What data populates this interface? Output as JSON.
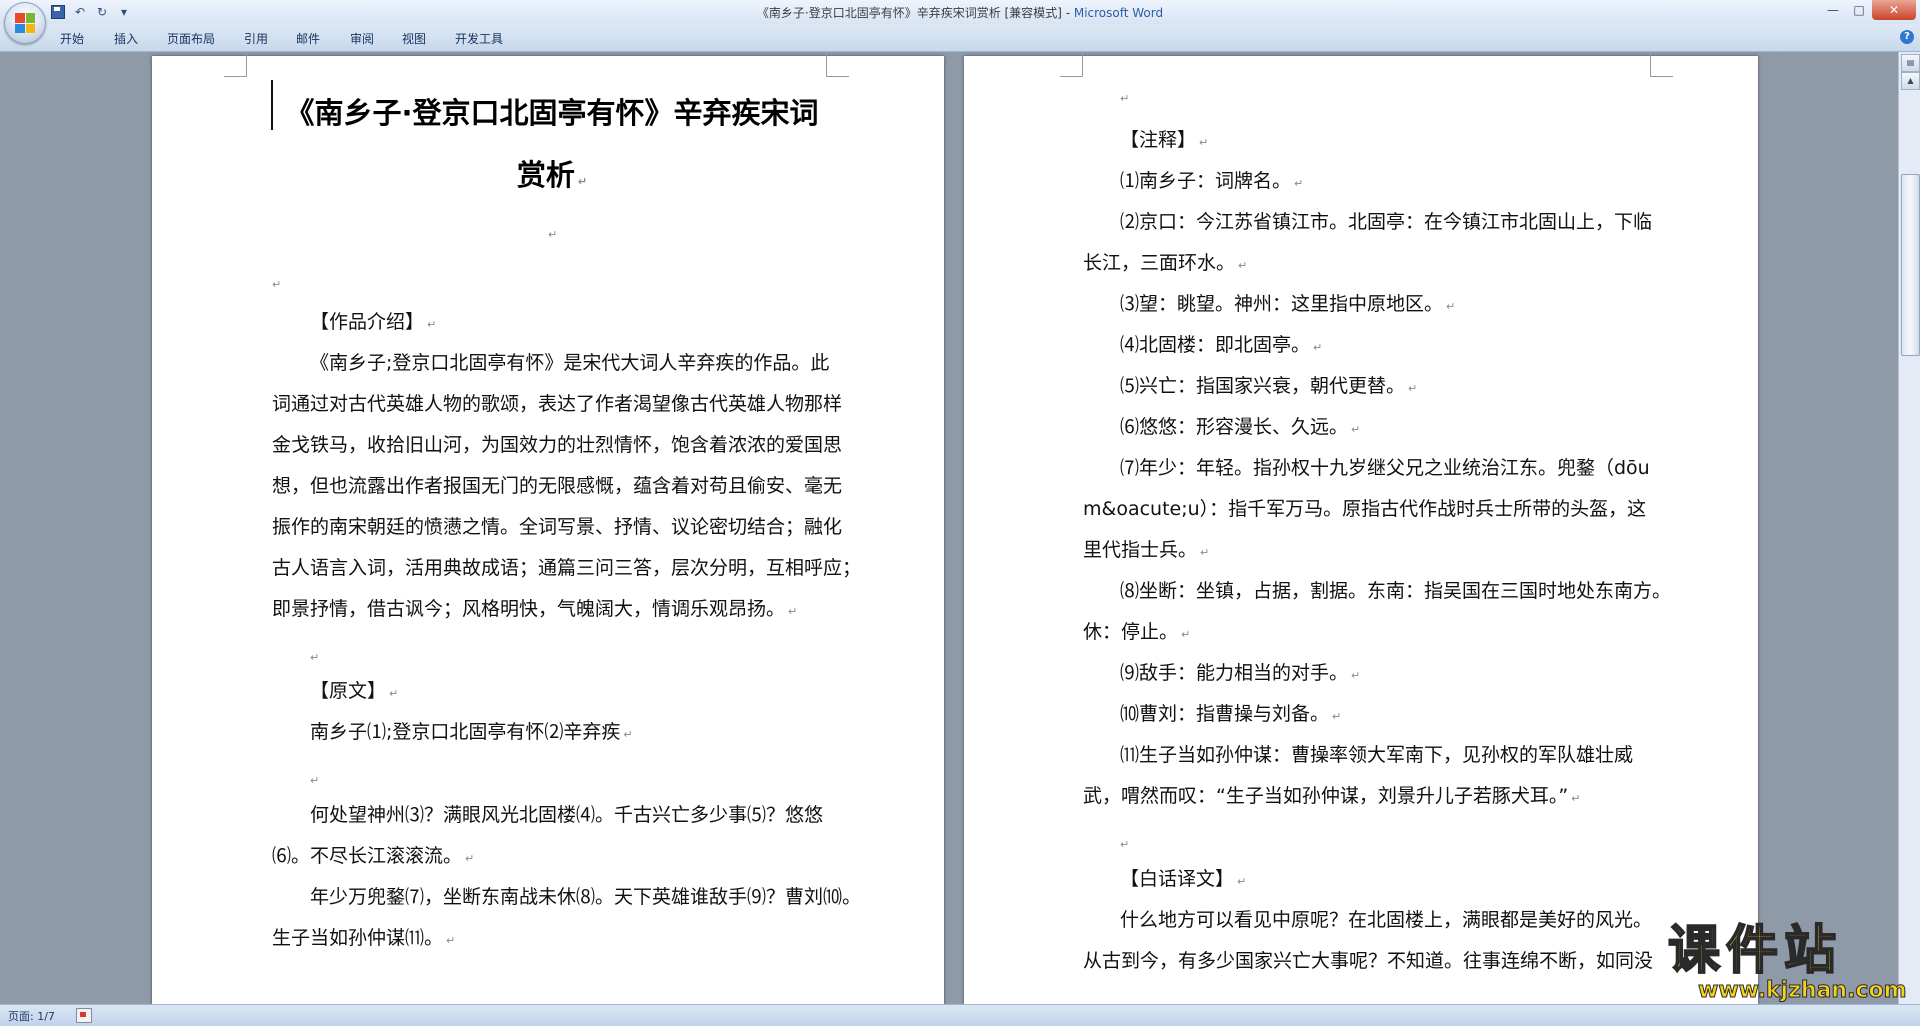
{
  "window": {
    "title_doc": "《南乡子·登京口北固亭有怀》辛弃疾宋词赏析 [兼容模式]",
    "title_sep": " - ",
    "title_app": "Microsoft Word"
  },
  "ribbon": {
    "tabs": [
      "开始",
      "插入",
      "页面布局",
      "引用",
      "邮件",
      "审阅",
      "视图",
      "开发工具"
    ]
  },
  "page_left": {
    "title_line1": "《南乡子·登京口北固亭有怀》辛弃疾宋词",
    "title_line2": "赏析",
    "intro_heading": "【作品介绍】",
    "intro_lines": [
      "《南乡子;登京口北固亭有怀》是宋代大词人辛弃疾的作品。此",
      "词通过对古代英雄人物的歌颂，表达了作者渴望像古代英雄人物那样",
      "金戈铁马，收拾旧山河，为国效力的壮烈情怀，饱含着浓浓的爱国思",
      "想，但也流露出作者报国无门的无限感慨，蕴含着对苟且偷安、毫无",
      "振作的南宋朝廷的愤懑之情。全词写景、抒情、议论密切结合；融化",
      "古人语言入词，活用典故成语；通篇三问三答，层次分明，互相呼应；",
      "即景抒情，借古讽今；风格明快，气魄阔大，情调乐观昂扬。"
    ],
    "original_heading": "【原文】",
    "poem_title": "南乡子⑴;登京口北固亭有怀⑵辛弃疾",
    "poem_lines": [
      "何处望神州⑶？满眼风光北固楼⑷。千古兴亡多少事⑸？悠悠",
      "⑹。不尽长江滚滚流。",
      "年少万兜鍪⑺，坐断东南战未休⑻。天下英雄谁敌手⑼？曹刘⑽。",
      "生子当如孙仲谋⑾。"
    ]
  },
  "page_right": {
    "notes_heading": "【注释】",
    "note_lines": [
      "⑴南乡子：词牌名。",
      "⑵京口：今江苏省镇江市。北固亭：在今镇江市北固山上，下临",
      "长江，三面环水。",
      "⑶望：眺望。神州：这里指中原地区。",
      "⑷北固楼：即北固亭。",
      "⑸兴亡：指国家兴衰，朝代更替。",
      "⑹悠悠：形容漫长、久远。",
      "⑺年少：年轻。指孙权十九岁继父兄之业统治江东。兜鍪（dōu",
      "m&oacute;u）：指千军万马。原指古代作战时兵士所带的头盔，这",
      "里代指士兵。",
      "⑻坐断：坐镇，占据，割据。东南：指吴国在三国时地处东南方。",
      "休：停止。",
      "⑼敌手：能力相当的对手。",
      "⑽曹刘：指曹操与刘备。",
      "⑾生子当如孙仲谋：曹操率领大军南下，见孙权的军队雄壮威",
      "武，喟然而叹：“生子当如孙仲谋，刘景升儿子若豚犬耳。”"
    ],
    "translation_heading": "【白话译文】",
    "translation_lines": [
      "什么地方可以看见中原呢？在北固楼上，满眼都是美好的风光。",
      "从古到今，有多少国家兴亡大事呢？不知道。往事连绵不断，如同没"
    ]
  },
  "statusbar": {
    "page_info": "页面: 1/7"
  },
  "watermark": {
    "cn": "课件站",
    "url": "www.kjzhan.com"
  },
  "icons": {
    "paragraph_mark": "↵",
    "qat_undo": "↶",
    "qat_redo": "↻",
    "qat_more": "▾",
    "help": "?"
  },
  "colors": {
    "title_app": "#2b5ea7",
    "workspace_bg": "#8f9aa8",
    "watermark": "#f5d21c"
  }
}
